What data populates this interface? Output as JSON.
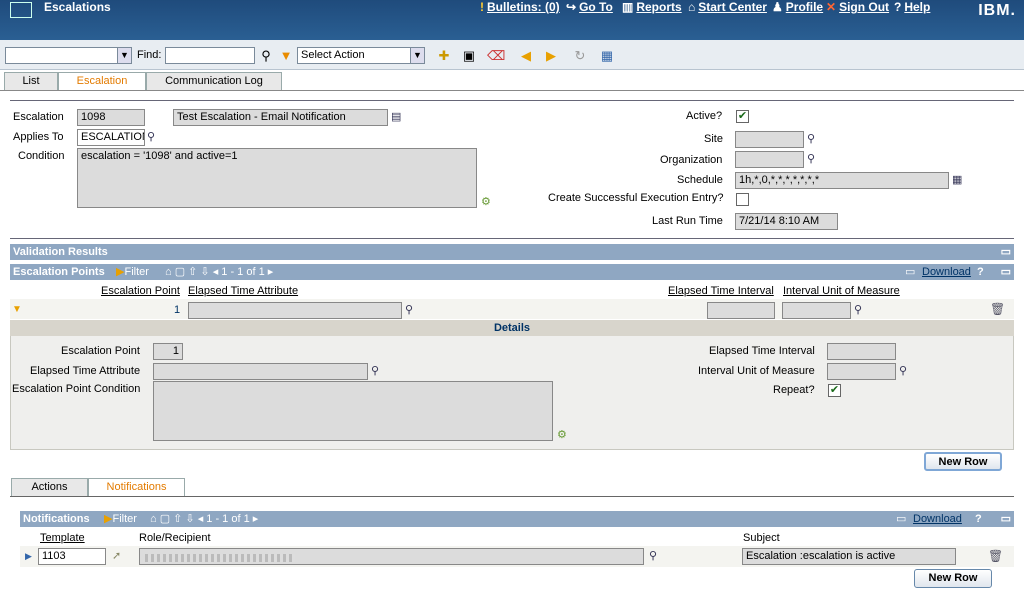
{
  "header": {
    "app_title": "Escalations",
    "nav": [
      {
        "label": "Bulletins: (0)",
        "icon": "bulletin-icon"
      },
      {
        "label": "Go To",
        "icon": "goto-icon"
      },
      {
        "label": "Reports",
        "icon": "reports-icon"
      },
      {
        "label": "Start Center",
        "icon": "home-icon"
      },
      {
        "label": "Profile",
        "icon": "profile-icon"
      },
      {
        "label": "Sign Out",
        "icon": "signout-icon"
      },
      {
        "label": "Help",
        "icon": "help-icon"
      }
    ],
    "brand": "IBM."
  },
  "toolbar": {
    "find_label": "Find:",
    "find_value": "",
    "action_select": "Select Action"
  },
  "tabs": [
    {
      "label": "List"
    },
    {
      "label": "Escalation",
      "active": true
    },
    {
      "label": "Communication Log"
    }
  ],
  "form": {
    "escalation_label": "Escalation",
    "escalation_value": "1098",
    "description_value": "Test Escalation - Email Notification",
    "applies_to_label": "Applies To",
    "applies_to_value": "ESCALATION",
    "condition_label": "Condition",
    "condition_value": "escalation = '1098' and active=1",
    "active_label": "Active?",
    "active_checked": true,
    "site_label": "Site",
    "organization_label": "Organization",
    "schedule_label": "Schedule",
    "schedule_value": "1h,*,0,*,*,*,*,*,*,*",
    "create_entry_label": "Create Successful Execution Entry?",
    "create_entry_checked": false,
    "last_run_label": "Last Run Time",
    "last_run_value": "7/21/14 8:10 AM"
  },
  "validation": {
    "title": "Validation Results"
  },
  "escalation_points": {
    "title": "Escalation Points",
    "filter": "Filter",
    "pager": "1 - 1 of 1",
    "download": "Download",
    "help": "?",
    "columns": [
      "Escalation Point",
      "Elapsed Time Attribute",
      "Elapsed Time Interval",
      "Interval Unit of Measure"
    ],
    "row": {
      "point": "1"
    },
    "details_title": "Details",
    "details": {
      "point_label": "Escalation Point",
      "point_value": "1",
      "eta_label": "Elapsed Time Attribute",
      "condition_label": "Escalation Point Condition",
      "interval_label": "Elapsed Time Interval",
      "unit_label": "Interval Unit of Measure",
      "repeat_label": "Repeat?",
      "repeat_checked": true
    },
    "new_row": "New Row"
  },
  "subtabs": [
    {
      "label": "Actions"
    },
    {
      "label": "Notifications",
      "active": true
    }
  ],
  "notifications": {
    "title": "Notifications",
    "filter": "Filter",
    "pager": "1 - 1 of 1",
    "download": "Download",
    "help": "?",
    "columns": [
      "Template",
      "Role/Recipient",
      "Subject"
    ],
    "row": {
      "template": "1103",
      "subject": "Escalation :escalation is active"
    },
    "new_row": "New Row"
  }
}
